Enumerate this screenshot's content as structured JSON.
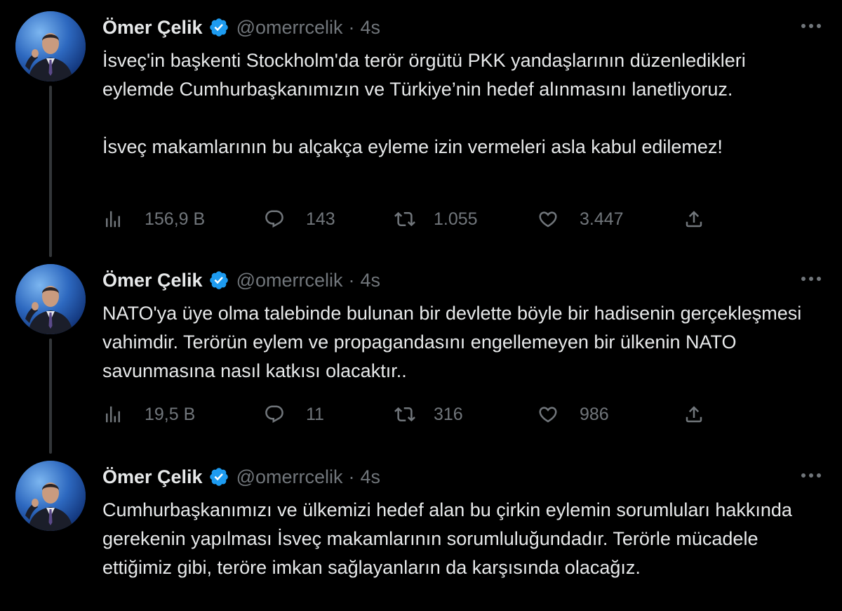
{
  "colors": {
    "background": "#000000",
    "text_primary": "#e7e9ea",
    "text_secondary": "#71767b",
    "verified_blue": "#1d9bf0",
    "thread_line": "#333639"
  },
  "tweets": [
    {
      "author": {
        "name": "Ömer Çelik",
        "handle": "@omerrcelik",
        "verified_icon": "verified-badge-icon"
      },
      "time": "4s",
      "paragraphs": [
        "İsveç'in başkenti Stockholm'da terör örgütü PKK yandaşlarının düzenledikleri eylemde Cumhurbaşkanımızın ve Türkiye’nin hedef alınmasını lanetliyoruz.",
        "İsveç makamlarının bu alçakça eyleme izin vermeleri asla kabul edilemez!"
      ],
      "stats": {
        "views": "156,9 B",
        "replies": "143",
        "retweets": "1.055",
        "likes": "3.447"
      }
    },
    {
      "author": {
        "name": "Ömer Çelik",
        "handle": "@omerrcelik",
        "verified_icon": "verified-badge-icon"
      },
      "time": "4s",
      "paragraphs": [
        "NATO'ya üye olma talebinde bulunan bir devlette böyle bir hadisenin gerçekleşmesi vahimdir. Terörün eylem ve propagandasını engellemeyen bir ülkenin NATO savunmasına nasıl katkısı olacaktır.."
      ],
      "stats": {
        "views": "19,5 B",
        "replies": "11",
        "retweets": "316",
        "likes": "986"
      }
    },
    {
      "author": {
        "name": "Ömer Çelik",
        "handle": "@omerrcelik",
        "verified_icon": "verified-badge-icon"
      },
      "time": "4s",
      "paragraphs": [
        "Cumhurbaşkanımızı ve ülkemizi hedef alan bu çirkin eylemin sorumluları hakkında gerekenin yapılması İsveç makamlarının sorumluluğundadır. Terörle mücadele ettiğimiz gibi, teröre imkan sağlayanların da karşısında olacağız."
      ]
    }
  ],
  "separator": "·",
  "icons": [
    "views-icon",
    "reply-icon",
    "retweet-icon",
    "like-icon",
    "share-icon",
    "more-options-icon",
    "verified-badge-icon"
  ]
}
